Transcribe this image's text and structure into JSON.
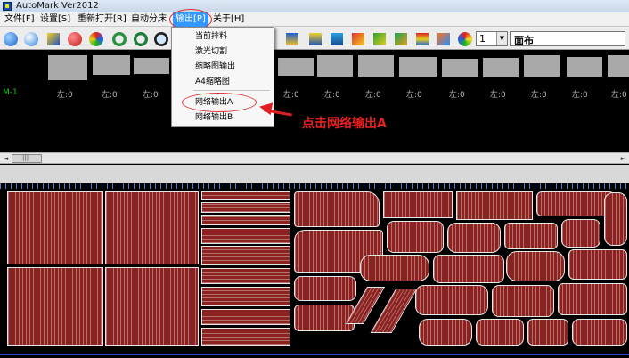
{
  "window": {
    "title": "AutoMark Ver2012"
  },
  "menubar": {
    "items": [
      "文件[F]",
      "设置[S]",
      "重新打开[R]",
      "自动分床",
      "输出[P]",
      "关于[H]"
    ]
  },
  "output_menu": {
    "items": [
      "当前排料",
      "激光切割",
      "缩略图输出",
      "A4缩略图",
      "网络输出A",
      "网络输出B"
    ],
    "highlighted": "网络输出A"
  },
  "toolbar": {
    "layer_value": "1",
    "fabric_value": "面布",
    "icons": [
      "globe-icon",
      "search-globe-icon",
      "arrows-icon",
      "ball-icon",
      "pinwheel-icon",
      "rotate-icon",
      "rotate-cw-icon",
      "zoom-icon",
      "up-arrow-icon",
      "layers-icon",
      "stack-icon",
      "book-icon",
      "scissors-icon",
      "star-icon",
      "layers-color-icon",
      "color-wheel-icon"
    ]
  },
  "thumbnail_panel": {
    "row_label": "M-1",
    "left_label": "左:0"
  },
  "annotation": {
    "text": "点击网络输出A"
  },
  "colors": {
    "piece_fill": "#8b2220",
    "annotation": "#e82020",
    "menu_highlight": "#3399ff",
    "row_label": "#20c020"
  }
}
